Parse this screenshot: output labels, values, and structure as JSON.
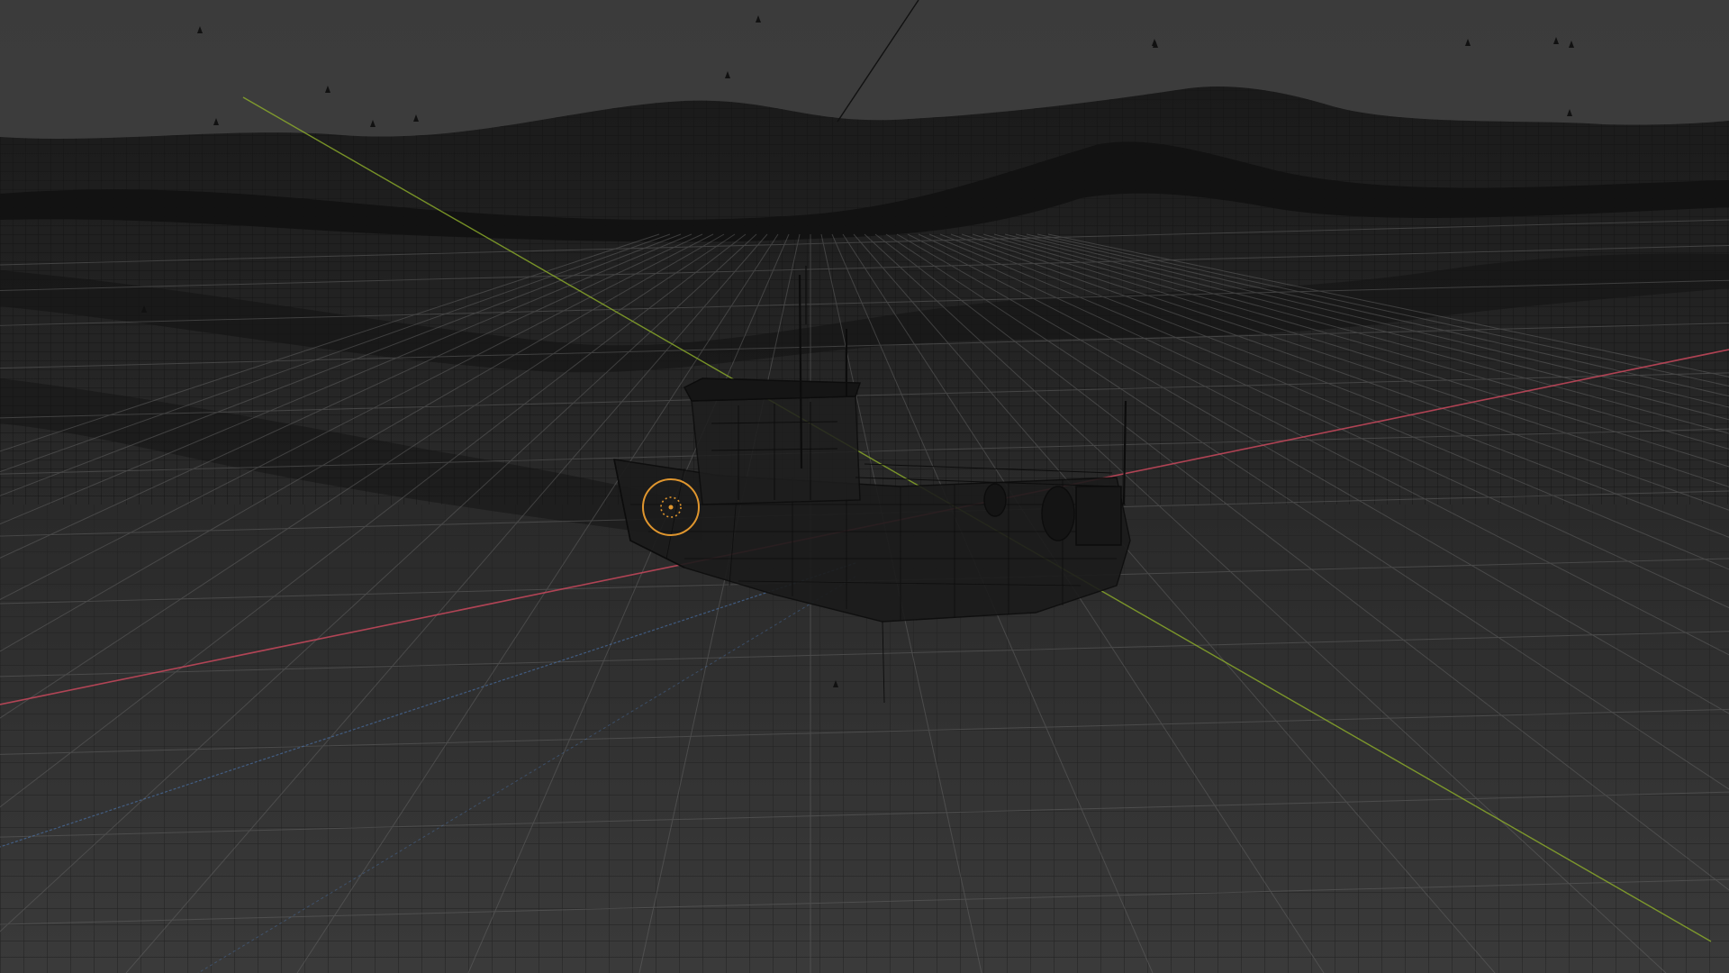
{
  "viewport": {
    "mode": "wireframe",
    "scene": "ocean-surface-with-boat",
    "colors": {
      "background_top": "#3b3b3b",
      "background_bottom": "#454545",
      "ocean_fill": "#2b2b2b",
      "wire_dark": "#151515",
      "wire_mid": "#1e1e1e",
      "grid_light": "#6e6e6e",
      "axis_x": "#c8485c",
      "axis_y": "#8fb02a",
      "axis_z": "#4d7ab8",
      "origin_ring": "#e0962e",
      "boat_wire": "#0c0c0c"
    },
    "icons": {
      "origin_marker": "3d-cursor-icon",
      "spray_particles": "particle-emitter-icon"
    }
  }
}
